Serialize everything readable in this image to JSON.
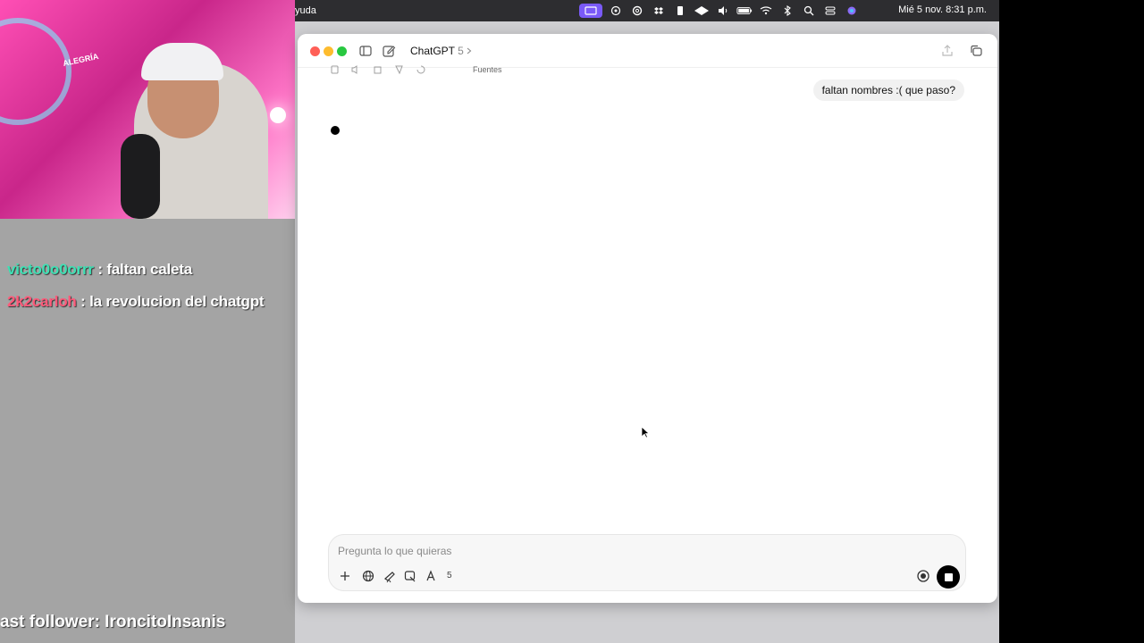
{
  "stream": {
    "chat": [
      {
        "user": "victo0o0orrr",
        "separator": " : ",
        "message": "faltan caleta"
      },
      {
        "user": "2k2carloh",
        "separator": " : ",
        "message": "la revolucion del chatgpt"
      }
    ],
    "last_follower": "ast follower: IroncitoInsanis",
    "webcam_sign": "ALEGRÍA"
  },
  "menubar": {
    "app_menu_fragment": "yuda",
    "clock": "Mié 5 nov.  8:31 p.m.",
    "status_icons": [
      "screen-share-icon",
      "chatgpt-icon",
      "threads-icon",
      "dropbox-icon",
      "battery-app-icon",
      "ai-icon",
      "volume-icon",
      "battery-icon",
      "wifi-icon",
      "bluetooth-icon",
      "search-icon",
      "control-center-icon",
      "siri-icon"
    ]
  },
  "window": {
    "title": "ChatGPT",
    "model_version": "5",
    "sources_label": "Fuentes",
    "user_message": "faltan nombres :( que paso?",
    "composer": {
      "placeholder": "Pregunta lo que quieras",
      "tool_count": "5"
    }
  }
}
